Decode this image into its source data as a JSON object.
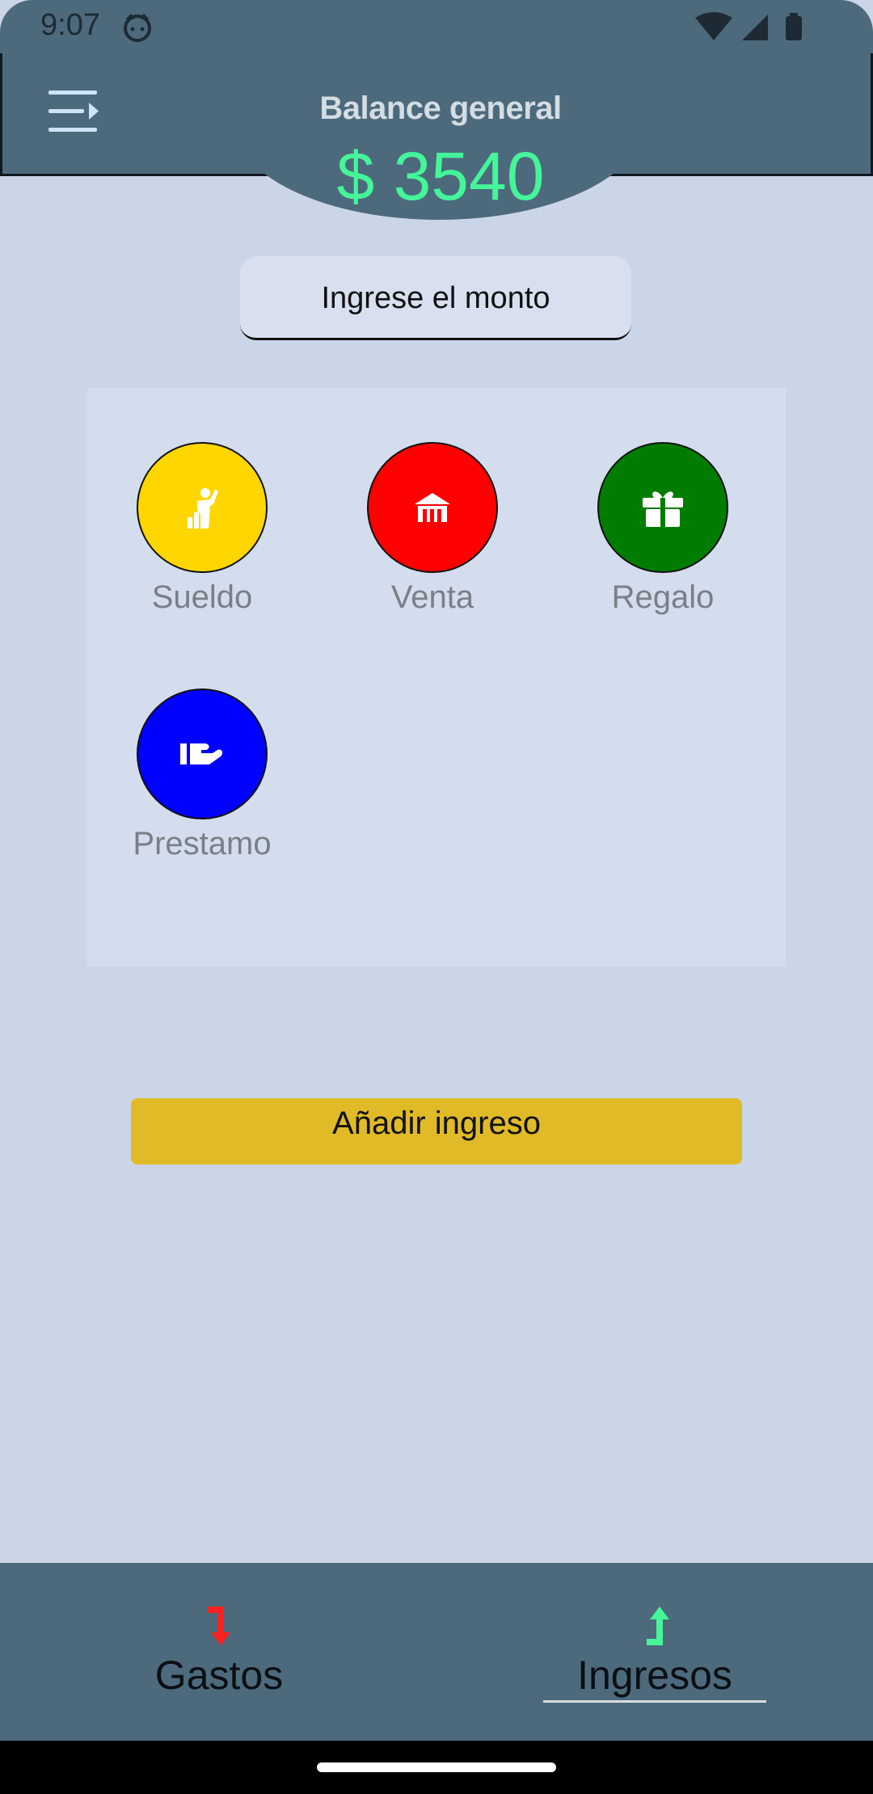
{
  "status_bar": {
    "time": "9:07"
  },
  "header": {
    "title": "Balance general",
    "amount": "$ 3540",
    "amount_color": "#44f59a"
  },
  "amount_input": {
    "placeholder": "Ingrese el monto"
  },
  "categories": [
    {
      "label": "Sueldo",
      "color": "#ffd600",
      "icon": "worker-icon"
    },
    {
      "label": "Venta",
      "color": "#ff0000",
      "icon": "store-icon"
    },
    {
      "label": "Regalo",
      "color": "#007d00",
      "icon": "gift-icon"
    },
    {
      "label": "Prestamo",
      "color": "#0000ff",
      "icon": "hand-money-icon"
    }
  ],
  "add_button": {
    "label": "Añadir ingreso",
    "color": "#e0bb27"
  },
  "bottom_nav": {
    "gastos": {
      "label": "Gastos",
      "icon": "arrow-down-icon",
      "color": "#ff2020"
    },
    "ingresos": {
      "label": "Ingresos",
      "icon": "arrow-up-icon",
      "color": "#44f59a",
      "selected": true
    }
  }
}
